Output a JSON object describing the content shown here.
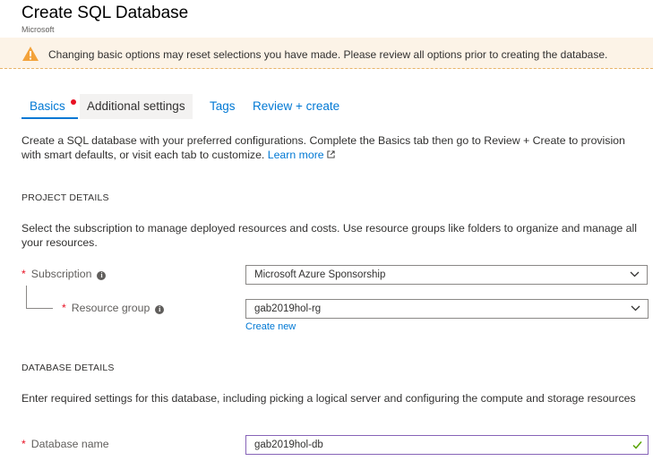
{
  "header": {
    "title": "Create SQL Database",
    "publisher": "Microsoft"
  },
  "banner": {
    "icon": "warning-icon",
    "text": "Changing basic options may reset selections you have made. Please review all options prior to creating the database."
  },
  "tabs": [
    {
      "label": "Basics",
      "selected": true,
      "has_error_dot": true
    },
    {
      "label": "Additional settings"
    },
    {
      "label": "Tags"
    },
    {
      "label": "Review + create"
    }
  ],
  "intro": {
    "text": "Create a SQL database with your preferred configurations. Complete the Basics tab then go to Review + Create to provision with smart defaults, or visit each tab to customize.",
    "learn_more": "Learn more"
  },
  "project_details": {
    "heading": "PROJECT DETAILS",
    "description": "Select the subscription to manage deployed resources and costs. Use resource groups like folders to organize and manage all your resources.",
    "subscription": {
      "label": "Subscription",
      "value": "Microsoft Azure Sponsorship"
    },
    "resource_group": {
      "label": "Resource group",
      "value": "gab2019hol-rg",
      "create_new": "Create new"
    }
  },
  "database_details": {
    "heading": "DATABASE DETAILS",
    "description": "Enter required settings for this database, including picking a logical server and configuring the compute and storage resources",
    "database_name": {
      "label": "Database name",
      "value": "gab2019hol-db"
    }
  },
  "colors": {
    "accent": "#0078d4",
    "error": "#e81123",
    "warning_bg": "#fcf3e7",
    "warning_icon": "#f3a23a",
    "valid_border": "#8764b8",
    "valid_check": "#57a300"
  }
}
